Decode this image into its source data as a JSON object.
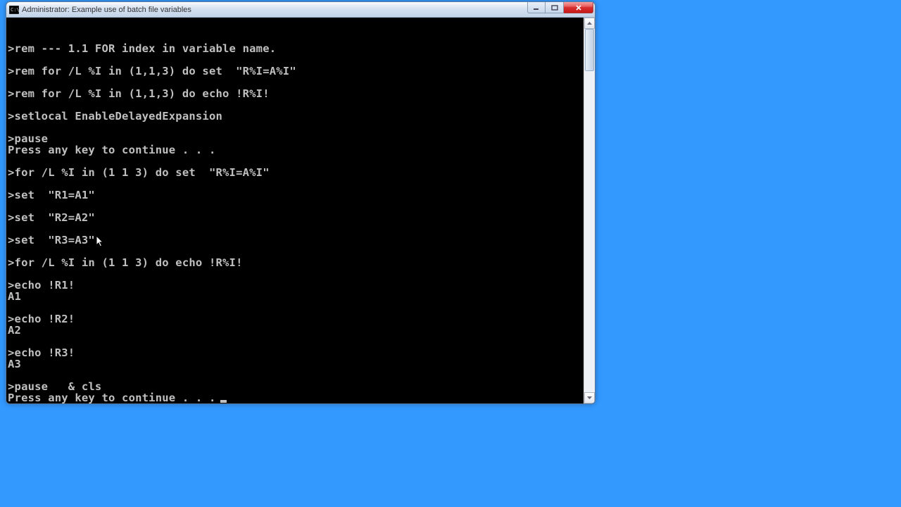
{
  "window": {
    "title": "Administrator:  Example use of batch file variables"
  },
  "terminal": {
    "lines": [
      "",
      "",
      ">rem --- 1.1 FOR index in variable name.",
      "",
      ">rem for /L %I in (1,1,3) do set  \"R%I=A%I\"",
      "",
      ">rem for /L %I in (1,1,3) do echo !R%I!",
      "",
      ">setlocal EnableDelayedExpansion",
      "",
      ">pause",
      "Press any key to continue . . .",
      "",
      ">for /L %I in (1 1 3) do set  \"R%I=A%I\"",
      "",
      ">set  \"R1=A1\"",
      "",
      ">set  \"R2=A2\"",
      "",
      ">set  \"R3=A3\"",
      "",
      ">for /L %I in (1 1 3) do echo !R%I!",
      "",
      ">echo !R1!",
      "A1",
      "",
      ">echo !R2!",
      "A2",
      "",
      ">echo !R3!",
      "A3",
      "",
      ">pause   & cls",
      "Press any key to continue . . ."
    ]
  }
}
